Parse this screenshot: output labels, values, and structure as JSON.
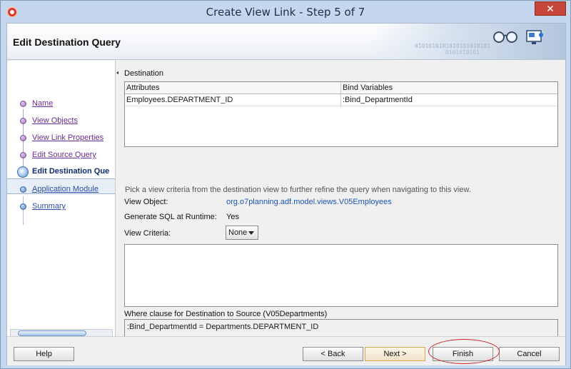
{
  "window": {
    "title": "Create View Link - Step 5 of 7",
    "close_label": "✕"
  },
  "header": {
    "title": "Edit Destination Query",
    "art_binary_1": "0101010101010101010101",
    "art_binary_2": "0101010101"
  },
  "nav": {
    "items": [
      {
        "label": "Name",
        "state": "done"
      },
      {
        "label": "View Objects",
        "state": "done"
      },
      {
        "label": "View Link Properties",
        "state": "done"
      },
      {
        "label": "Edit Source Query",
        "state": "done"
      },
      {
        "label": "Edit Destination Que",
        "state": "current"
      },
      {
        "label": "Application Module",
        "state": "todo"
      },
      {
        "label": "Summary",
        "state": "todo"
      }
    ]
  },
  "destination": {
    "label": "Destination",
    "columns": [
      "Attributes",
      "Bind Variables"
    ],
    "rows": [
      {
        "attribute": "Employees.DEPARTMENT_ID",
        "bind_variable": ":Bind_DepartmentId"
      }
    ]
  },
  "criteria": {
    "hint": "Pick a view criteria from the destination view to further refine the query when navigating to this view.",
    "view_object_label": "View Object:",
    "view_object_value": "org.o7planning.adf.model.views.V05Employees",
    "sql_runtime_label": "Generate SQL at Runtime:",
    "sql_runtime_value": "Yes",
    "view_criteria_label": "View Criteria:",
    "view_criteria_value": "None"
  },
  "where_clause": {
    "label": "Where clause for Destination to Source (V05Departments)",
    "value": ":Bind_DepartmentId = Departments.DEPARTMENT_ID"
  },
  "footer": {
    "help_label": "Help",
    "back_label": "< Back",
    "next_label": "Next >",
    "finish_label": "Finish",
    "cancel_label": "Cancel"
  },
  "colors": {
    "annotation_circle": "#c3282a",
    "link_visited": "#6a2b92",
    "link": "#2c4fa8"
  }
}
